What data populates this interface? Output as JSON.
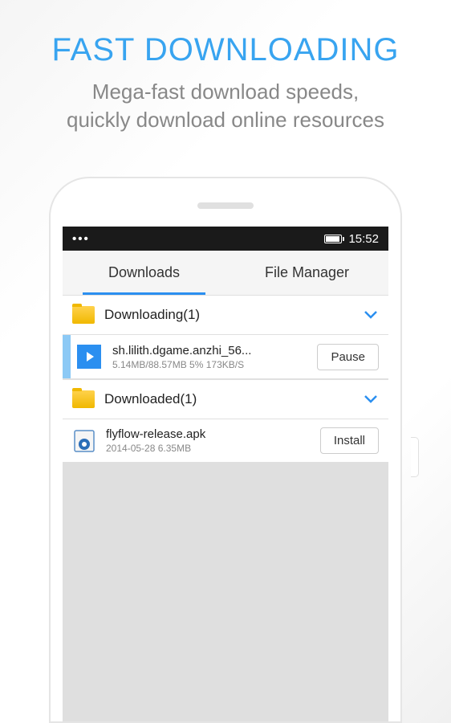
{
  "hero": {
    "title": "FAST DOWNLOADING",
    "subtitle_line1": "Mega-fast download speeds,",
    "subtitle_line2": "quickly download online resources"
  },
  "statusbar": {
    "menu": "•••",
    "time": "15:52"
  },
  "tabs": {
    "downloads": "Downloads",
    "file_manager": "File Manager"
  },
  "sections": {
    "downloading": {
      "label": "Downloading(1)"
    },
    "downloaded": {
      "label": "Downloaded(1)"
    }
  },
  "items": {
    "downloading_file": {
      "name": "sh.lilith.dgame.anzhi_56...",
      "meta": "5.14MB/88.57MB 5% 173KB/S",
      "action": "Pause"
    },
    "downloaded_file": {
      "name": "flyflow-release.apk",
      "meta": "2014-05-28   6.35MB",
      "action": "Install"
    }
  }
}
